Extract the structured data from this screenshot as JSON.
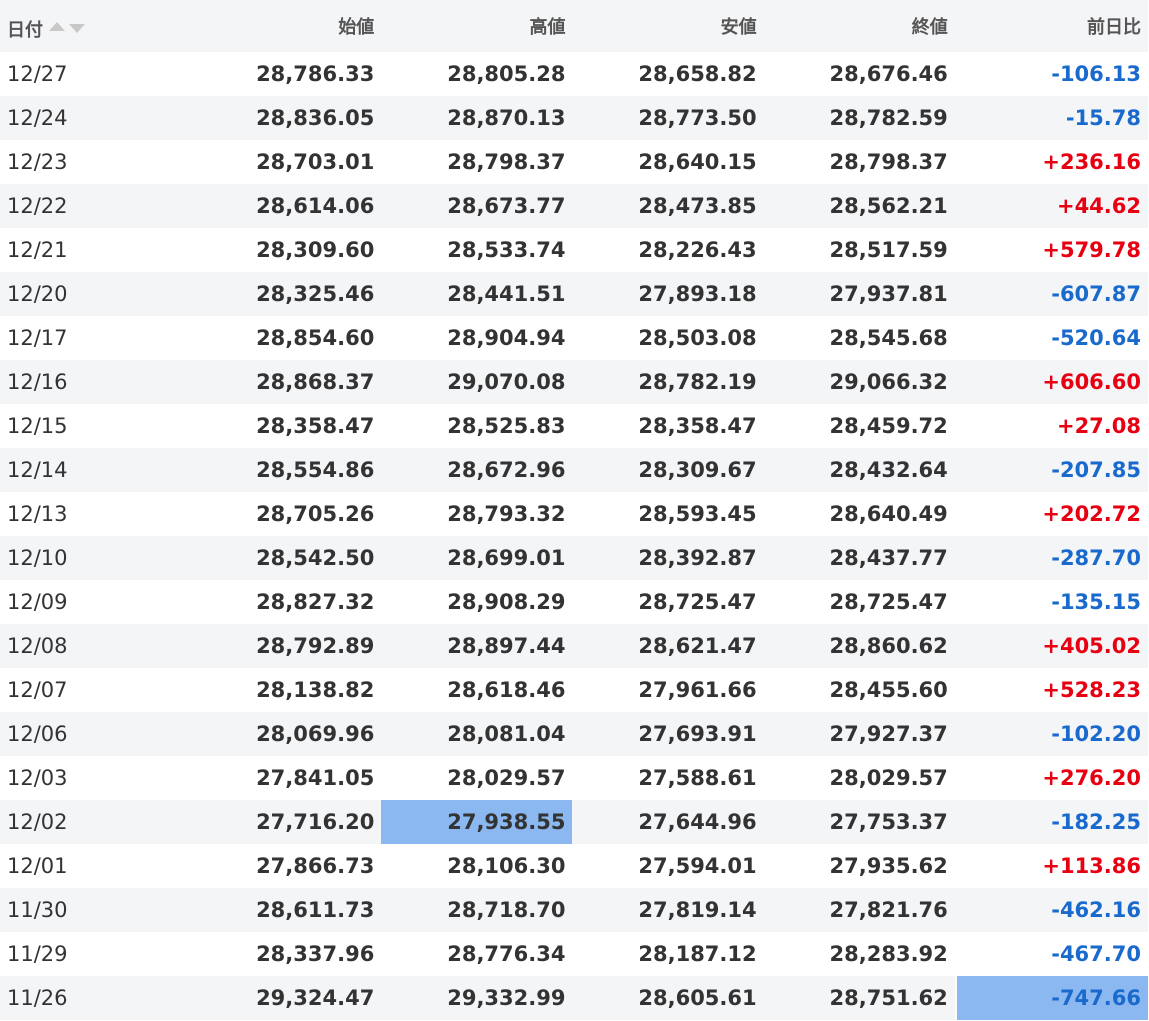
{
  "headers": {
    "date": "日付",
    "open": "始値",
    "high": "高値",
    "low": "安値",
    "close": "終値",
    "change": "前日比"
  },
  "colors": {
    "positive": "#e60012",
    "negative": "#1a6acd",
    "highlight": "#8bb8f0",
    "stripe": "#f4f5f7"
  },
  "rows": [
    {
      "date": "12/27",
      "open": "28,786.33",
      "high": "28,805.28",
      "low": "28,658.82",
      "close": "28,676.46",
      "change": "-106.13"
    },
    {
      "date": "12/24",
      "open": "28,836.05",
      "high": "28,870.13",
      "low": "28,773.50",
      "close": "28,782.59",
      "change": "-15.78"
    },
    {
      "date": "12/23",
      "open": "28,703.01",
      "high": "28,798.37",
      "low": "28,640.15",
      "close": "28,798.37",
      "change": "+236.16"
    },
    {
      "date": "12/22",
      "open": "28,614.06",
      "high": "28,673.77",
      "low": "28,473.85",
      "close": "28,562.21",
      "change": "+44.62"
    },
    {
      "date": "12/21",
      "open": "28,309.60",
      "high": "28,533.74",
      "low": "28,226.43",
      "close": "28,517.59",
      "change": "+579.78"
    },
    {
      "date": "12/20",
      "open": "28,325.46",
      "high": "28,441.51",
      "low": "27,893.18",
      "close": "27,937.81",
      "change": "-607.87"
    },
    {
      "date": "12/17",
      "open": "28,854.60",
      "high": "28,904.94",
      "low": "28,503.08",
      "close": "28,545.68",
      "change": "-520.64"
    },
    {
      "date": "12/16",
      "open": "28,868.37",
      "high": "29,070.08",
      "low": "28,782.19",
      "close": "29,066.32",
      "change": "+606.60"
    },
    {
      "date": "12/15",
      "open": "28,358.47",
      "high": "28,525.83",
      "low": "28,358.47",
      "close": "28,459.72",
      "change": "+27.08"
    },
    {
      "date": "12/14",
      "open": "28,554.86",
      "high": "28,672.96",
      "low": "28,309.67",
      "close": "28,432.64",
      "change": "-207.85"
    },
    {
      "date": "12/13",
      "open": "28,705.26",
      "high": "28,793.32",
      "low": "28,593.45",
      "close": "28,640.49",
      "change": "+202.72"
    },
    {
      "date": "12/10",
      "open": "28,542.50",
      "high": "28,699.01",
      "low": "28,392.87",
      "close": "28,437.77",
      "change": "-287.70"
    },
    {
      "date": "12/09",
      "open": "28,827.32",
      "high": "28,908.29",
      "low": "28,725.47",
      "close": "28,725.47",
      "change": "-135.15"
    },
    {
      "date": "12/08",
      "open": "28,792.89",
      "high": "28,897.44",
      "low": "28,621.47",
      "close": "28,860.62",
      "change": "+405.02"
    },
    {
      "date": "12/07",
      "open": "28,138.82",
      "high": "28,618.46",
      "low": "27,961.66",
      "close": "28,455.60",
      "change": "+528.23"
    },
    {
      "date": "12/06",
      "open": "28,069.96",
      "high": "28,081.04",
      "low": "27,693.91",
      "close": "27,927.37",
      "change": "-102.20"
    },
    {
      "date": "12/03",
      "open": "27,841.05",
      "high": "28,029.57",
      "low": "27,588.61",
      "close": "28,029.57",
      "change": "+276.20"
    },
    {
      "date": "12/02",
      "open": "27,716.20",
      "high": "27,938.55",
      "low": "27,644.96",
      "close": "27,753.37",
      "change": "-182.25",
      "highlight": "high"
    },
    {
      "date": "12/01",
      "open": "27,866.73",
      "high": "28,106.30",
      "low": "27,594.01",
      "close": "27,935.62",
      "change": "+113.86"
    },
    {
      "date": "11/30",
      "open": "28,611.73",
      "high": "28,718.70",
      "low": "27,819.14",
      "close": "27,821.76",
      "change": "-462.16"
    },
    {
      "date": "11/29",
      "open": "28,337.96",
      "high": "28,776.34",
      "low": "28,187.12",
      "close": "28,283.92",
      "change": "-467.70"
    },
    {
      "date": "11/26",
      "open": "29,324.47",
      "high": "29,332.99",
      "low": "28,605.61",
      "close": "28,751.62",
      "change": "-747.66",
      "highlight": "change"
    }
  ]
}
